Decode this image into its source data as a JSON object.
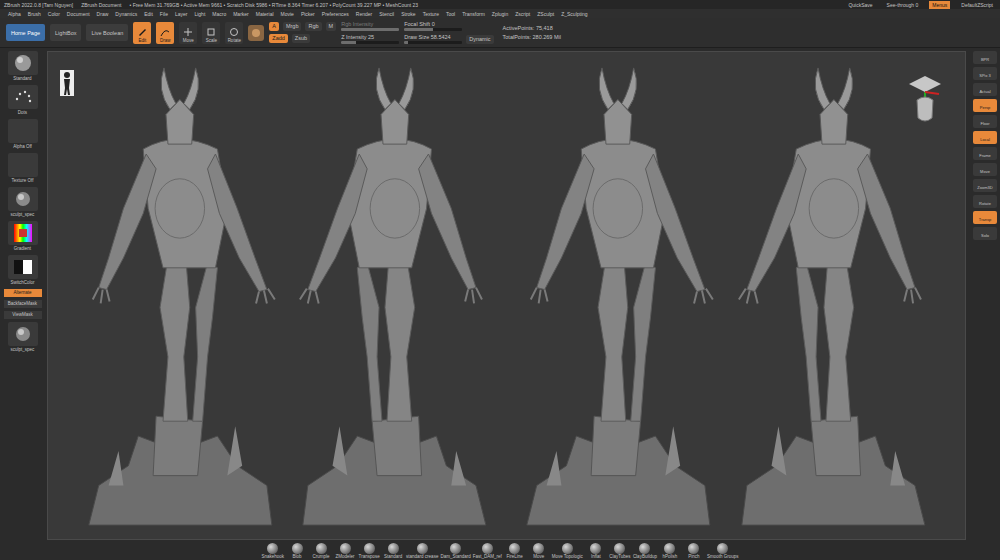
{
  "title_bar": {
    "app": "ZBrush 2022.0.8 [Tam Nguyen]",
    "document": "ZBrush Document",
    "stats": "• Free Mem 31.769GB • Active Mem 9661 • Scratch Disk 5986 • RTime 8.364 Timer 6.207 • PolyCount 39.227 MP • MeshCount 23",
    "buttons": [
      {
        "label": "QuickSave",
        "selected": false
      },
      {
        "label": "See-through 0",
        "selected": false
      },
      {
        "label": "Menus",
        "selected": true
      },
      {
        "label": "DefaultZScript",
        "selected": false
      }
    ]
  },
  "menu_bar": [
    "Alpha",
    "Brush",
    "Color",
    "Document",
    "Draw",
    "Dynamics",
    "Edit",
    "File",
    "Layer",
    "Light",
    "Macro",
    "Marker",
    "Material",
    "Movie",
    "Picker",
    "Preferences",
    "Render",
    "Stencil",
    "Stroke",
    "Texture",
    "Tool",
    "Transform",
    "Zplugin",
    "Zscript",
    "ZSculpt",
    "Z_Sculpting"
  ],
  "toolbar": {
    "nav": [
      {
        "label": "Home Page",
        "selected": true
      },
      {
        "label": "LightBox",
        "selected": false
      },
      {
        "label": "Live Boolean",
        "selected": false
      }
    ],
    "modes": [
      {
        "label": "Edit",
        "selected": true
      },
      {
        "label": "Draw",
        "selected": true
      },
      {
        "label": "Move",
        "selected": false
      },
      {
        "label": "Scale",
        "selected": false
      },
      {
        "label": "Rotate",
        "selected": false
      }
    ],
    "color_row": [
      {
        "label": "A",
        "selected": true
      },
      {
        "label": "Mrgb",
        "selected": false
      },
      {
        "label": "Rgb",
        "selected": false
      },
      {
        "label": "M",
        "selected": false
      }
    ],
    "z_row": [
      {
        "label": "Zadd",
        "selected": true
      },
      {
        "label": "Zsub",
        "selected": false
      }
    ],
    "sliders": [
      {
        "label": "Rgb Intensity",
        "level": 1,
        "disabled": true
      },
      {
        "label": "Z Intensity 25",
        "level": 0.25,
        "disabled": false
      },
      {
        "label": "Focal Shift 0",
        "level": 0.5,
        "disabled": false
      },
      {
        "label": "Draw Size 58.5424",
        "level": 0.06,
        "disabled": false
      }
    ],
    "dynamic": "Dynamic",
    "stats": [
      "ActivePoints: 75,418",
      "TotalPoints: 280.269 Mil"
    ]
  },
  "left_shelf": [
    {
      "label": "Standard",
      "kind": "sphere"
    },
    {
      "label": "Dots",
      "kind": "dots"
    },
    {
      "label": "Alpha Off",
      "kind": "blank"
    },
    {
      "label": "Texture Off",
      "kind": "blank"
    },
    {
      "label": "sculpt_spec",
      "kind": "material"
    },
    {
      "label": "Gradient",
      "kind": "picker"
    },
    {
      "label": "SwitchColor",
      "kind": "swatch"
    },
    {
      "label": "Alternate",
      "kind": "button",
      "selected": true
    },
    {
      "label": "BackfaceMask",
      "kind": "button",
      "selected": false
    },
    {
      "label": "ViewMask",
      "kind": "button",
      "selected": false
    },
    {
      "label": "sculpt_spec",
      "kind": "material"
    }
  ],
  "right_shelf": [
    {
      "label": "BPR",
      "selected": false
    },
    {
      "label": "SPix 3",
      "selected": false
    },
    {
      "label": "Actual",
      "selected": false
    },
    {
      "label": "Persp",
      "selected": true
    },
    {
      "label": "Floor",
      "selected": false
    },
    {
      "label": "Local",
      "selected": true
    },
    {
      "label": "Frame",
      "selected": false
    },
    {
      "label": "Move",
      "selected": false
    },
    {
      "label": "Zoom3D",
      "selected": false
    },
    {
      "label": "Rotate",
      "selected": false
    },
    {
      "label": "Transp",
      "selected": true
    },
    {
      "label": "Solo",
      "selected": false
    }
  ],
  "brushes": [
    "Snakehook",
    "Blob",
    "Crumple",
    "ZModeler",
    "Transpose",
    "Standard",
    "standard crease",
    "Dam_Standard",
    "Fast_DAM_ref",
    "FireLine",
    "Move",
    "Move Topologic",
    "Inflat",
    "ClayTubes",
    "ClayBuildup",
    "hPolish",
    "Pinch",
    "Smooth Groups"
  ]
}
